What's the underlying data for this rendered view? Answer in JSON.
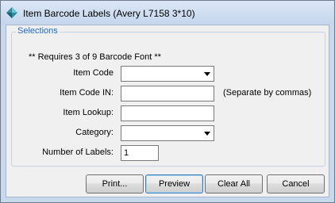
{
  "window": {
    "title": "Item Barcode Labels (Avery L7158 3*10)",
    "icon": "app-diamond-icon"
  },
  "selections": {
    "legend": "Selections",
    "note": "** Requires 3 of 9 Barcode Font **",
    "item_code_label": "Item Code",
    "item_code_value": "",
    "item_code_in_label": "Item Code IN:",
    "item_code_in_value": "",
    "item_code_in_hint": "(Separate by commas)",
    "item_lookup_label": "Item Lookup:",
    "item_lookup_value": "",
    "category_label": "Category:",
    "category_value": "",
    "number_of_labels_label": "Number of Labels:",
    "number_of_labels_value": "1"
  },
  "buttons": {
    "print": "Print...",
    "preview": "Preview",
    "clear_all": "Clear All",
    "cancel": "Cancel"
  },
  "colors": {
    "legend": "#1e6bd6",
    "titlebar": "#c9d9ed"
  }
}
